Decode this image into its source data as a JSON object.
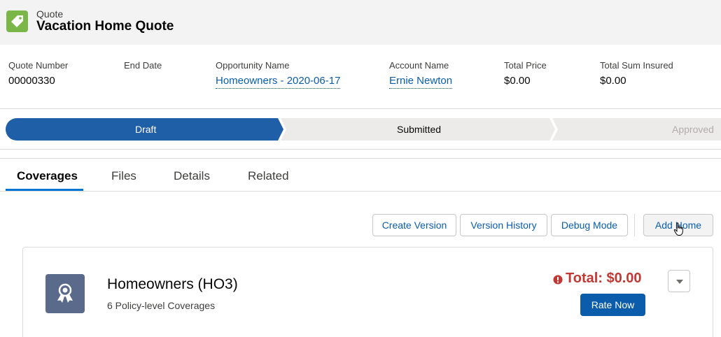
{
  "header": {
    "object_type": "Quote",
    "title": "Vacation Home Quote",
    "icon": "tag-icon",
    "icon_color": "#7ab648"
  },
  "highlights": [
    {
      "label": "Quote Number",
      "value": "00000330",
      "is_link": false
    },
    {
      "label": "End Date",
      "value": "",
      "is_link": false
    },
    {
      "label": "Opportunity Name",
      "value": "Homeowners - 2020-06-17",
      "is_link": true
    },
    {
      "label": "Account Name",
      "value": "Ernie Newton",
      "is_link": true
    },
    {
      "label": "Total Price",
      "value": "$0.00",
      "is_link": false
    },
    {
      "label": "Total Sum Insured",
      "value": "$0.00",
      "is_link": false
    }
  ],
  "path": {
    "stages": [
      {
        "label": "Draft",
        "state": "current"
      },
      {
        "label": "Submitted",
        "state": "incomplete"
      },
      {
        "label": "Approved",
        "state": "incomplete"
      }
    ],
    "current_color": "#1f5fa8"
  },
  "tabs": [
    {
      "label": "Coverages",
      "active": true
    },
    {
      "label": "Files",
      "active": false
    },
    {
      "label": "Details",
      "active": false
    },
    {
      "label": "Related",
      "active": false
    }
  ],
  "actions": {
    "create_version": "Create Version",
    "version_history": "Version History",
    "debug_mode": "Debug Mode",
    "add_home": "Add Home"
  },
  "product": {
    "name": "Homeowners (HO3)",
    "subtitle": "6 Policy-level Coverages",
    "icon": "award-ribbon-icon",
    "total": "Total: $0.00",
    "total_color": "#c23934",
    "rate_button": "Rate Now"
  }
}
